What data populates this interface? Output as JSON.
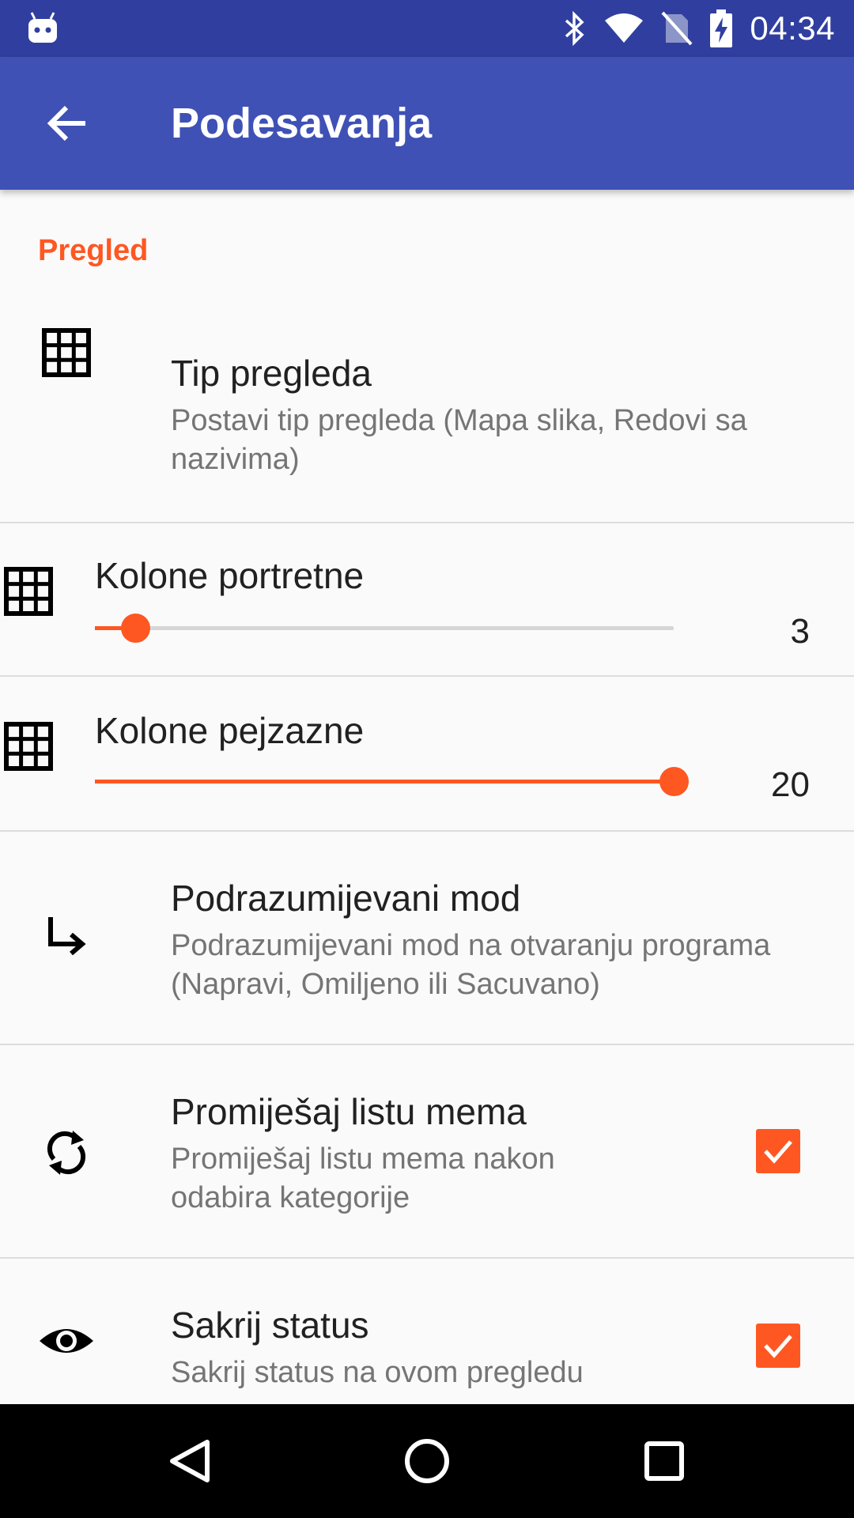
{
  "status_bar": {
    "time": "04:34",
    "icons": [
      "android-icon",
      "bluetooth-icon",
      "wifi-icon",
      "no-sim-icon",
      "battery-charging-icon"
    ]
  },
  "app_bar": {
    "title": "Podesavanja",
    "back_icon": "arrow-back-icon"
  },
  "category": "Pregled",
  "preferences": [
    {
      "title": "Tip pregleda",
      "summary": "Postavi tip pregleda (Mapa slika, Redovi sa nazivima)",
      "icon": "grid-icon"
    },
    {
      "title": "Kolone portretne",
      "icon": "grid-icon",
      "slider": {
        "value": "3",
        "fraction": 0.07
      }
    },
    {
      "title": "Kolone pejzazne",
      "icon": "grid-icon",
      "slider": {
        "value": "20",
        "fraction": 1.0
      }
    },
    {
      "title": "Podrazumijevani mod",
      "summary": "Podrazumijevani mod na otvaranju programa (Napravi, Omiljeno ili Sacuvano)",
      "icon": "subdirectory-arrow-icon"
    },
    {
      "title": "Promiješaj listu mema",
      "summary": "Promiješaj listu mema nakon odabira kategorije",
      "icon": "sync-icon",
      "checked": true
    },
    {
      "title": "Sakrij status",
      "summary": "Sakrij status na ovom pregledu",
      "icon": "eye-icon",
      "checked": true
    }
  ],
  "nav_bar": {
    "icons": [
      "back-triangle-icon",
      "home-circle-icon",
      "recents-square-icon"
    ]
  },
  "colors": {
    "primary": "#3f51b5",
    "primary_dark": "#303f9f",
    "accent": "#ff5722"
  }
}
